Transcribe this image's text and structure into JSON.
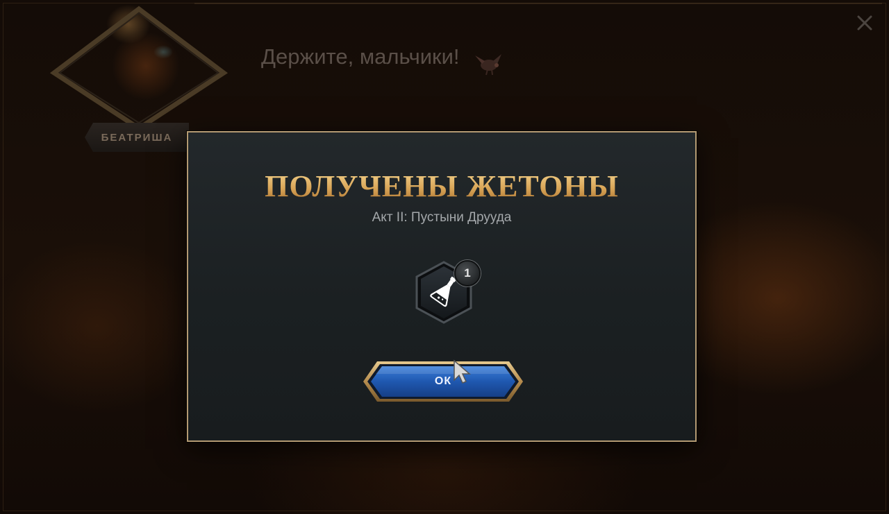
{
  "scene": {
    "character_name": "БЕАТРИША",
    "speech": "Держите, мальчики!",
    "close_icon": "close-icon"
  },
  "modal": {
    "title": "ПОЛУЧЕНЫ ЖЕТОНЫ",
    "subtitle": "Акт II: Пустыни Друуда",
    "token": {
      "icon": "potion-flask-icon",
      "count": "1"
    },
    "ok_label": "ОК"
  },
  "colors": {
    "title_gold": "#d9a85a",
    "modal_border": "#b49a72",
    "button_blue": "#1f58b0",
    "modal_bg": "#1d2225"
  }
}
